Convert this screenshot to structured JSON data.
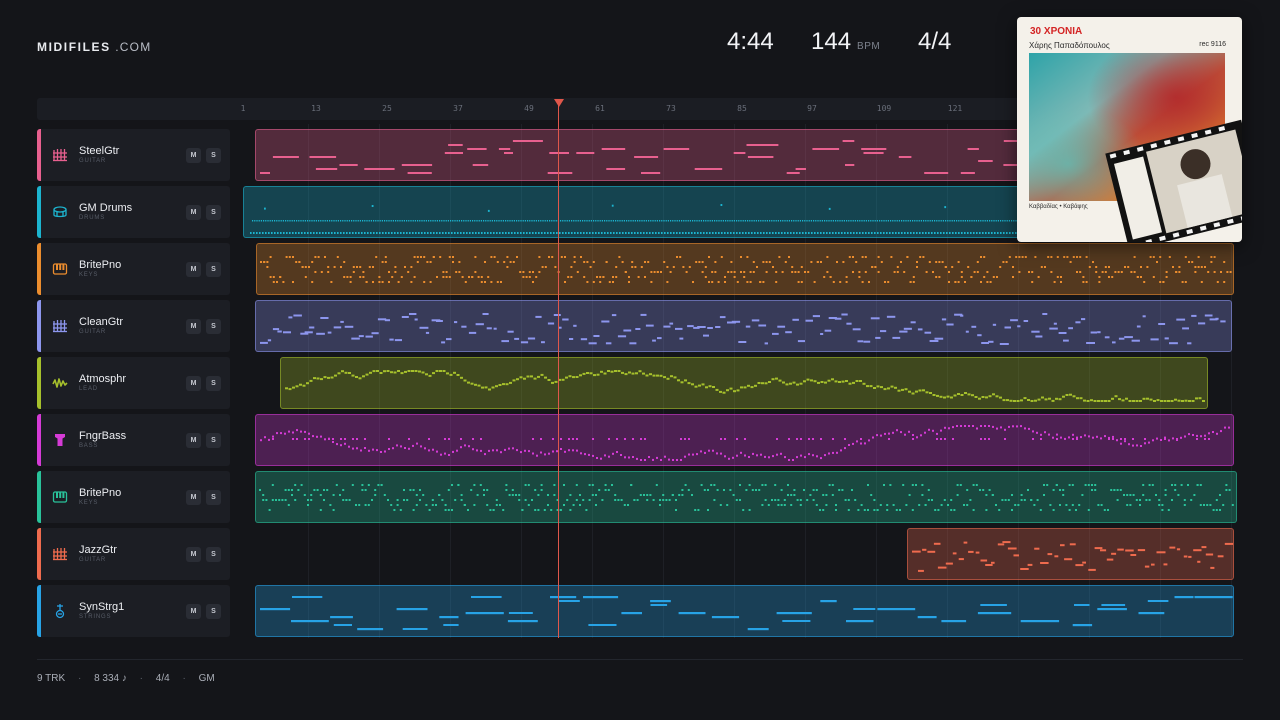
{
  "brand": {
    "name": "MIDIFILES",
    "suffix": " .COM"
  },
  "transport": {
    "time": "4:44",
    "tempo": "144",
    "tempo_unit": "BPM",
    "meter": "4/4"
  },
  "ruler": {
    "ticks": [
      "1",
      "13",
      "25",
      "37",
      "49",
      "61",
      "73",
      "85",
      "97",
      "109",
      "121"
    ]
  },
  "colors": {
    "pink": "#e8608f",
    "cyan": "#1cb4cf",
    "orange": "#ec8d2e",
    "periwinkle": "#8d96ee",
    "olive": "#a6c02c",
    "magenta": "#d53bd6",
    "teal": "#29c29a",
    "coral": "#ef6b4e",
    "blue": "#27a3e6",
    "playhead": "#e0574b"
  },
  "tracks": [
    {
      "name": "SteelGtr",
      "category": "GUITAR",
      "icon": "guitar-grid-icon",
      "color": "#e8608f",
      "mute": "M",
      "solo": "S"
    },
    {
      "name": "GM Drums",
      "category": "DRUMS",
      "icon": "drum-icon",
      "color": "#1cb4cf",
      "mute": "M",
      "solo": "S"
    },
    {
      "name": "BritePno",
      "category": "KEYS",
      "icon": "piano-keys-icon",
      "color": "#ec8d2e",
      "mute": "M",
      "solo": "S"
    },
    {
      "name": "CleanGtr",
      "category": "GUITAR",
      "icon": "guitar-grid-icon",
      "color": "#8d96ee",
      "mute": "M",
      "solo": "S"
    },
    {
      "name": "Atmosphr",
      "category": "LEAD",
      "icon": "waveform-icon",
      "color": "#a6c02c",
      "mute": "M",
      "solo": "S"
    },
    {
      "name": "FngrBass",
      "category": "BASS",
      "icon": "bass-icon",
      "color": "#d53bd6",
      "mute": "M",
      "solo": "S"
    },
    {
      "name": "BritePno",
      "category": "KEYS",
      "icon": "piano-keys-icon",
      "color": "#29c29a",
      "mute": "M",
      "solo": "S"
    },
    {
      "name": "JazzGtr",
      "category": "GUITAR",
      "icon": "guitar-grid-icon",
      "color": "#ef6b4e",
      "mute": "M",
      "solo": "S"
    },
    {
      "name": "SynStrg1",
      "category": "STRINGS",
      "icon": "violin-icon",
      "color": "#27a3e6",
      "mute": "M",
      "solo": "S"
    }
  ],
  "footer": {
    "tracks": "9 TRK",
    "notes": "8 334 ♪",
    "meter": "4/4",
    "standard": "GM",
    "separator": "·"
  },
  "album": {
    "title": "30 ΧΡΟΝΙΑ",
    "artist": "Χάρης Παπαδόπουλος",
    "catalog": "rec 9116",
    "credits": "Καββαδίας • Καβάφης"
  }
}
